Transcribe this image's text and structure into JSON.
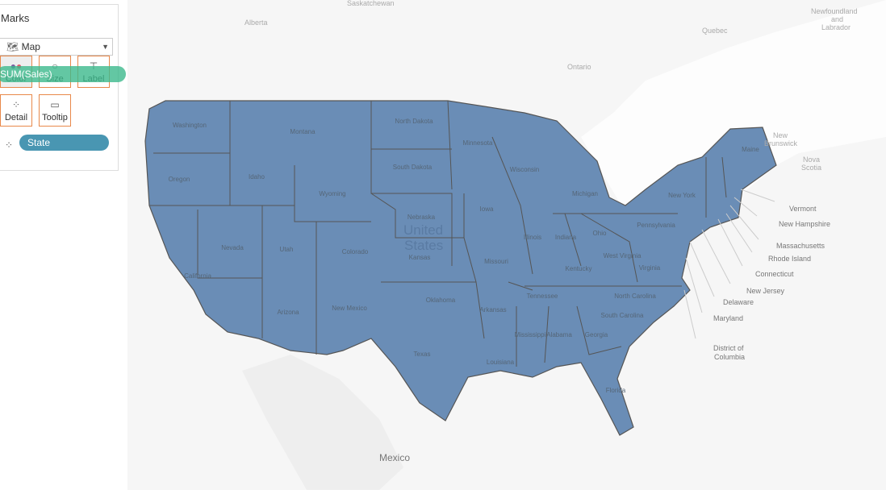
{
  "marks": {
    "title": "Marks",
    "mark_type": "Map",
    "buttons": {
      "color": "Color",
      "size": "Size",
      "label": "Label",
      "detail": "Detail",
      "tooltip": "Tooltip"
    },
    "state_pill": "State",
    "dragging_pill": "SUM(Sales)"
  },
  "map": {
    "fill_color": "#6a8db6",
    "region_labels": {
      "saskatchewan": "Saskatchewan",
      "alberta": "Alberta",
      "quebec": "Quebec",
      "newfoundland": "Newfoundland",
      "labrador": "and",
      "labrador2": "Labrador",
      "ontario": "Ontario",
      "new_brunswick1": "New",
      "new_brunswick2": "Brunswick",
      "nova1": "Nova",
      "nova2": "Scotia",
      "us1": "United",
      "us2": "States",
      "mexico": "Mexico"
    },
    "states": [
      "Washington",
      "Oregon",
      "California",
      "Nevada",
      "Idaho",
      "Montana",
      "Wyoming",
      "Utah",
      "Arizona",
      "Colorado",
      "New Mexico",
      "North Dakota",
      "South Dakota",
      "Nebraska",
      "Kansas",
      "Oklahoma",
      "Texas",
      "Minnesota",
      "Iowa",
      "Missouri",
      "Arkansas",
      "Louisiana",
      "Wisconsin",
      "Illinois",
      "Michigan",
      "Indiana",
      "Ohio",
      "Kentucky",
      "Tennessee",
      "Mississippi",
      "Alabama",
      "Georgia",
      "Florida",
      "South Carolina",
      "North Carolina",
      "Virginia",
      "West Virginia",
      "Pennsylvania",
      "New York",
      "Maine"
    ],
    "callouts": [
      "Vermont",
      "New Hampshire",
      "Massachusetts",
      "Rhode Island",
      "Connecticut",
      "New Jersey",
      "Delaware",
      "Maryland",
      "District of",
      "Columbia"
    ]
  }
}
